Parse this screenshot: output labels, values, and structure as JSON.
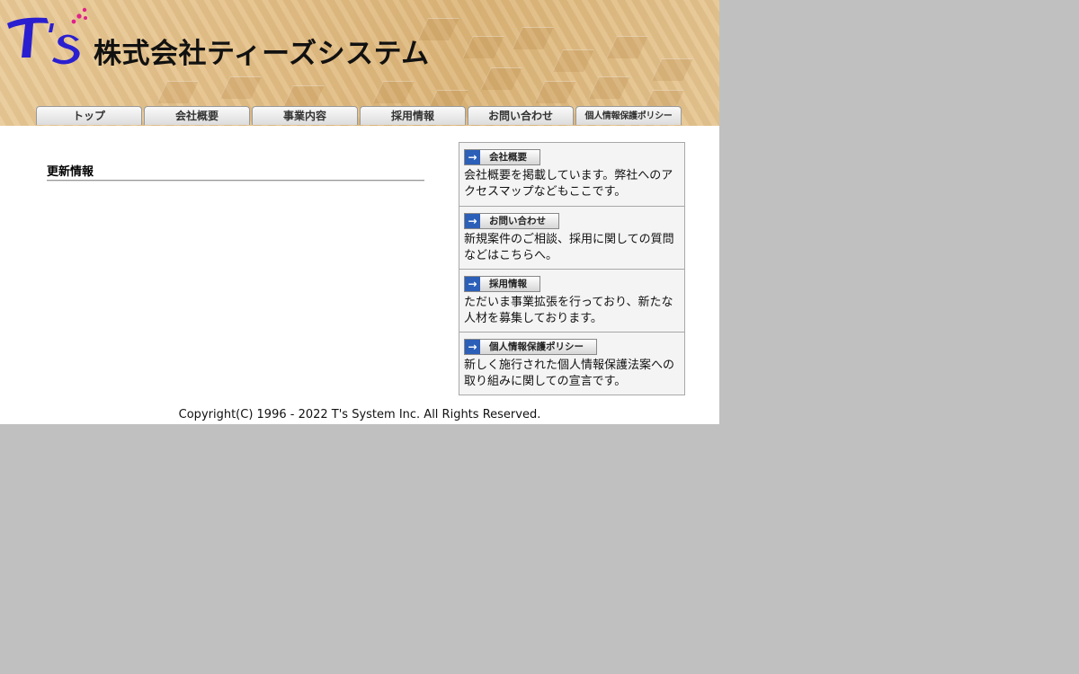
{
  "header": {
    "logo_text": "T's",
    "company_name": "株式会社ティーズシステム"
  },
  "tabs": [
    {
      "label": "トップ"
    },
    {
      "label": "会社概要"
    },
    {
      "label": "事業内容"
    },
    {
      "label": "採用情報"
    },
    {
      "label": "お問い合わせ"
    },
    {
      "label": "個人情報保護ポリシー"
    }
  ],
  "updates": {
    "heading": "更新情報"
  },
  "side_boxes": [
    {
      "button_label": "会社概要",
      "text": "会社概要を掲載しています。弊社へのアクセスマップなどもここです。"
    },
    {
      "button_label": "お問い合わせ",
      "text": "新規案件のご相談、採用に関しての質問などはこちらへ。"
    },
    {
      "button_label": "採用情報",
      "text": "ただいま事業拡張を行っており、新たな人材を募集しております。"
    },
    {
      "button_label": "個人情報保護ポリシー",
      "text": "新しく施行された個人情報保護法案への取り組みに関しての宣言です。"
    }
  ],
  "footer": {
    "copyright": "Copyright(C) 1996 - 2022 T's System Inc. All Rights Reserved."
  },
  "colors": {
    "page_bg": "#c0c0c0",
    "logo_blue": "#2a1fd0",
    "logo_pink": "#e0208a",
    "arrow_blue": "#2b5fb8"
  }
}
